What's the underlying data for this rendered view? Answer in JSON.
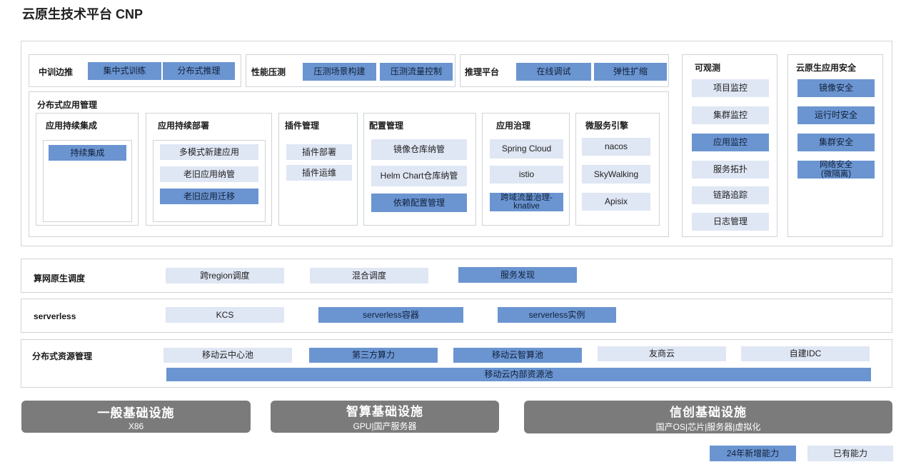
{
  "title": "云原生技术平台 CNP",
  "top_groups": {
    "training": {
      "label": "中训边推",
      "items": [
        "集中式训练",
        "分布式推理"
      ]
    },
    "stress": {
      "label": "性能压测",
      "items": [
        "压测场景构建",
        "压测流量控制"
      ]
    },
    "inference": {
      "label": "推理平台",
      "items": [
        "在线调试",
        "弹性扩缩"
      ]
    }
  },
  "dist_app": {
    "label": "分布式应用管理",
    "ci": {
      "label": "应用持续集成",
      "items": [
        "持续集成"
      ]
    },
    "cd": {
      "label": "应用持续部署",
      "items": [
        "多模式新建应用",
        "老旧应用纳管",
        "老旧应用迁移"
      ]
    },
    "plugin": {
      "label": "插件管理",
      "items": [
        "插件部署",
        "插件运维"
      ]
    },
    "config": {
      "label": "配置管理",
      "items": [
        "镜像仓库纳管",
        "Helm Chart仓库纳管",
        "依赖配置管理"
      ]
    },
    "governance": {
      "label": "应用治理",
      "items": [
        "Spring Cloud",
        "istio",
        "跨域流量治理-",
        "knative"
      ]
    },
    "micro": {
      "label": "微服务引擎",
      "items": [
        "nacos",
        "SkyWalking",
        "Apisix"
      ]
    }
  },
  "observability": {
    "label": "可观测",
    "items": [
      "项目监控",
      "集群监控",
      "应用监控",
      "服务拓扑",
      "链路追踪",
      "日志管理"
    ]
  },
  "security": {
    "label": "云原生应用安全",
    "items": [
      "镜像安全",
      "运行时安全",
      "集群安全",
      "网络安全",
      "(微隔离)"
    ]
  },
  "scheduling": {
    "label": "算网原生调度",
    "items": [
      "跨region调度",
      "混合调度",
      "服务发现"
    ]
  },
  "serverless": {
    "label": "serverless",
    "items": [
      "KCS",
      "serverless容器",
      "serverless实例"
    ]
  },
  "resource": {
    "label": "分布式资源管理",
    "items": [
      "移动云中心池",
      "第三方算力",
      "移动云智算池",
      "友商云",
      "自建IDC",
      "移动云内部资源池"
    ]
  },
  "infra": [
    {
      "title": "一般基础设施",
      "sub": "X86"
    },
    {
      "title": "智算基础设施",
      "sub": "GPU|国产服务器"
    },
    {
      "title": "信创基础设施",
      "sub": "国产OS|芯片|服务器|虚拟化"
    }
  ],
  "legend": {
    "new": "24年新增能力",
    "existing": "已有能力"
  },
  "colors": {
    "new_capability": "#6b95d1",
    "existing_capability": "#dfe6f4",
    "infrastructure": "#7b7b7b",
    "frame_border": "#cfd3d8"
  }
}
